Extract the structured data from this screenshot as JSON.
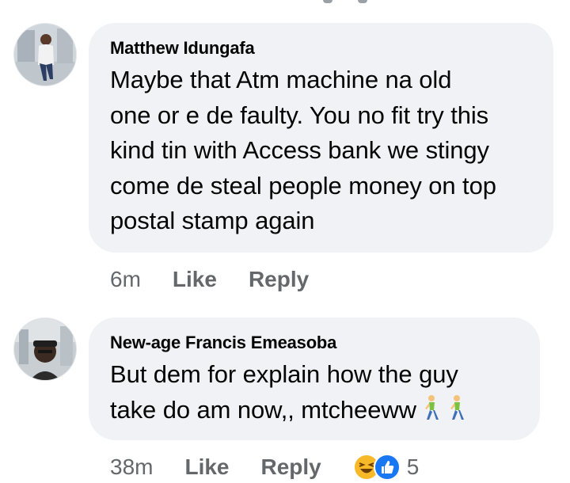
{
  "comments": [
    {
      "author": "Matthew Idungafa",
      "text": "Maybe that Atm machine na old\none or e de faulty. You no fit try this\nkind tin with Access bank we stingy\ncome de steal people money on top\npostal stamp again",
      "time": "6m",
      "like_label": "Like",
      "reply_label": "Reply"
    },
    {
      "author": "New-age Francis Emeasoba",
      "text": "But dem for explain how the guy\ntake do am now,, mtcheeww",
      "emoji_walkers": 2,
      "time": "38m",
      "like_label": "Like",
      "reply_label": "Reply",
      "reaction_count": "5",
      "reaction_icons": [
        "haha-reaction-icon",
        "like-reaction-icon"
      ]
    }
  ],
  "colors": {
    "bubble": "#f0f2f5",
    "text": "#050505",
    "meta": "#65676b",
    "like_blue": "#1877f2",
    "haha_yellow": "#f7b928"
  }
}
